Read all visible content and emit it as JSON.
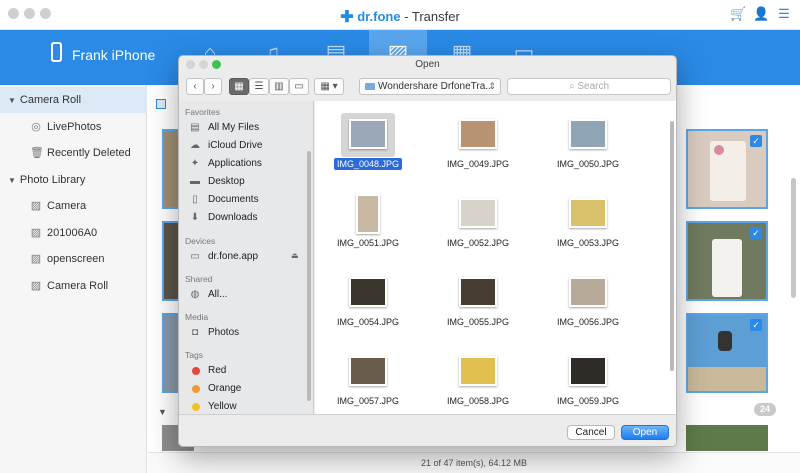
{
  "app": {
    "title_brand": "dr.fone",
    "title_rest": " - Transfer",
    "device_name": "Frank iPhone"
  },
  "sidebar": {
    "items": [
      {
        "label": "Camera Roll",
        "type": "head",
        "icon": "triangle-down-icon"
      },
      {
        "label": "LivePhotos",
        "type": "sub",
        "icon": "live-photo-icon"
      },
      {
        "label": "Recently Deleted",
        "type": "sub",
        "icon": "trash-icon"
      },
      {
        "label": "Photo Library",
        "type": "head",
        "icon": "triangle-down-icon"
      },
      {
        "label": "Camera",
        "type": "sub",
        "icon": "image-icon"
      },
      {
        "label": "201006A0",
        "type": "sub",
        "icon": "image-icon"
      },
      {
        "label": "openscreen",
        "type": "sub",
        "icon": "image-icon"
      },
      {
        "label": "Camera Roll",
        "type": "sub",
        "icon": "image-icon"
      }
    ]
  },
  "content": {
    "count_badge": "24",
    "status": "21 of 47 item(s), 64.12 MB"
  },
  "dialog": {
    "title": "Open",
    "path": "Wondershare DrfoneTra...",
    "search_placeholder": "Search",
    "favorites_head": "Favorites",
    "favorites": [
      {
        "label": "All My Files",
        "icon": "all-files-icon"
      },
      {
        "label": "iCloud Drive",
        "icon": "cloud-icon"
      },
      {
        "label": "Applications",
        "icon": "applications-icon"
      },
      {
        "label": "Desktop",
        "icon": "desktop-icon"
      },
      {
        "label": "Documents",
        "icon": "documents-icon"
      },
      {
        "label": "Downloads",
        "icon": "downloads-icon"
      }
    ],
    "devices_head": "Devices",
    "device_item": "dr.fone.app",
    "shared_head": "Shared",
    "shared_item": "All...",
    "media_head": "Media",
    "media_item": "Photos",
    "tags_head": "Tags",
    "tags": [
      {
        "label": "Red",
        "color": "#e8453c"
      },
      {
        "label": "Orange",
        "color": "#f19a2f"
      },
      {
        "label": "Yellow",
        "color": "#f2c31f"
      }
    ],
    "files": [
      "IMG_0048.JPG",
      "IMG_0049.JPG",
      "IMG_0050.JPG",
      "IMG_0051.JPG",
      "IMG_0052.JPG",
      "IMG_0053.JPG",
      "IMG_0054.JPG",
      "IMG_0055.JPG",
      "IMG_0056.JPG",
      "IMG_0057.JPG",
      "IMG_0058.JPG",
      "IMG_0059.JPG"
    ],
    "cancel_label": "Cancel",
    "open_label": "Open"
  },
  "colors": {
    "accent": "#2a8ae6",
    "selection": "#2a6bd9"
  }
}
